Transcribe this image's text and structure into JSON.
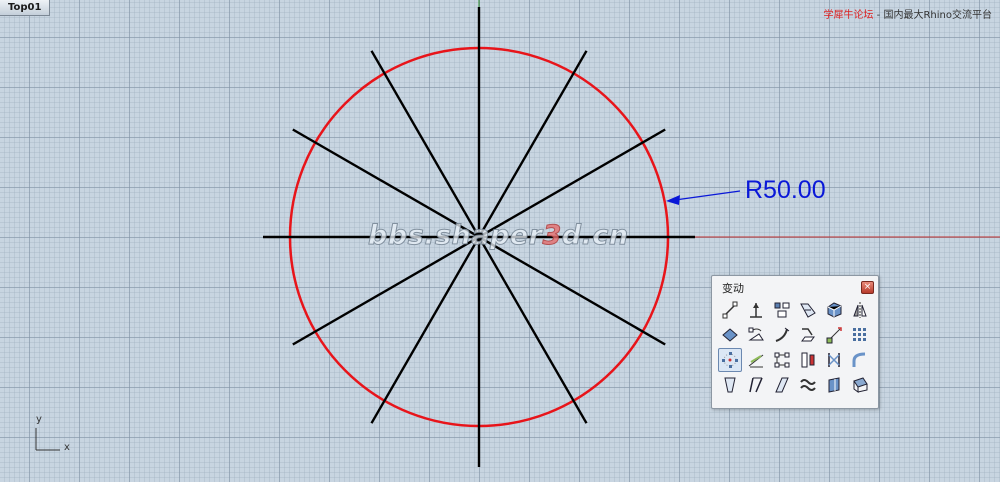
{
  "viewport": {
    "tab_label": "Top01",
    "watermark_prefix": "bbs.shaper",
    "watermark_accent": "3",
    "watermark_suffix": "d.cn",
    "header_brand": "学犀牛论坛",
    "header_sep": " - ",
    "header_slogan": "国内最大Rhino交流平台",
    "axis_y_label": "y",
    "axis_x_label": "x"
  },
  "drawing": {
    "circle_color": "#e8141a",
    "line_color": "#000000",
    "dimension_color": "#0a18d8",
    "dimension_text": "R50.00",
    "radius": 50,
    "spoke_count": 6
  },
  "toolbar": {
    "title": "变动",
    "close_glyph": "×",
    "tools": [
      {
        "name": "move-tool",
        "icon": "move-icon",
        "active": false
      },
      {
        "name": "copy-tool",
        "icon": "copy-icon",
        "active": false
      },
      {
        "name": "align-tool",
        "icon": "align-icon",
        "active": false
      },
      {
        "name": "scale-tool",
        "icon": "scale-icon",
        "active": false
      },
      {
        "name": "box-edit-tool",
        "icon": "box-icon",
        "active": false
      },
      {
        "name": "mirror-tool",
        "icon": "mirror-icon",
        "active": false
      },
      {
        "name": "orient-tool",
        "icon": "orient-icon",
        "active": false
      },
      {
        "name": "rotate-tool",
        "icon": "rotate-icon",
        "active": false
      },
      {
        "name": "bend-tool",
        "icon": "bend-icon",
        "active": false
      },
      {
        "name": "project-tool",
        "icon": "project-icon",
        "active": false
      },
      {
        "name": "set-points-tool",
        "icon": "set-points-icon",
        "active": false
      },
      {
        "name": "array-tool",
        "icon": "array-icon",
        "active": false
      },
      {
        "name": "polar-array-tool",
        "icon": "polar-array-icon",
        "active": true
      },
      {
        "name": "shear-tool",
        "icon": "shear-icon",
        "active": false
      },
      {
        "name": "array-curve-tool",
        "icon": "array-curve-icon",
        "active": false
      },
      {
        "name": "array-surface-tool",
        "icon": "array-surface-icon",
        "active": false
      },
      {
        "name": "twist-tool",
        "icon": "twist-icon",
        "active": false
      },
      {
        "name": "flow-tool",
        "icon": "flow-icon",
        "active": false
      },
      {
        "name": "taper-tool",
        "icon": "taper-icon",
        "active": false
      },
      {
        "name": "stretch-tool",
        "icon": "stretch-icon",
        "active": false
      },
      {
        "name": "skew-tool",
        "icon": "skew-icon",
        "active": false
      },
      {
        "name": "smooth-tool",
        "icon": "smooth-icon",
        "active": false
      },
      {
        "name": "splop-tool",
        "icon": "splop-icon",
        "active": false
      },
      {
        "name": "cage-edit-tool",
        "icon": "cage-icon",
        "active": false
      }
    ]
  }
}
